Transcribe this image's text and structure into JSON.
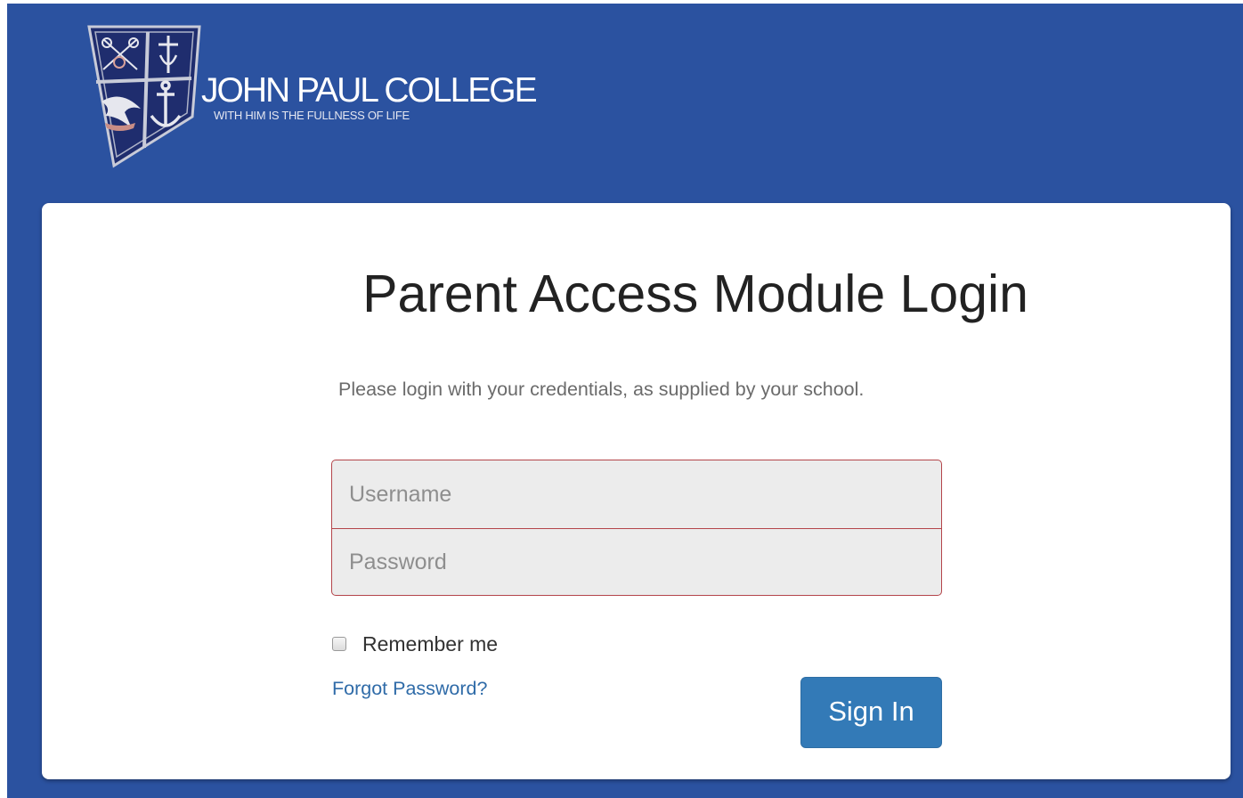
{
  "header": {
    "logo": {
      "school_name": "JOHN PAUL COLLEGE",
      "motto": "WITH HIM IS THE FULLNESS OF LIFE",
      "shield_icons": [
        "crossed-keys-icon",
        "cross-icon",
        "dolphin-icon",
        "anchor-icon"
      ]
    }
  },
  "login": {
    "title": "Parent Access Module Login",
    "instructions": "Please login with your credentials, as supplied by your school.",
    "username_placeholder": "Username",
    "password_placeholder": "Password",
    "remember_label": "Remember me",
    "forgot_label": "Forgot Password?",
    "signin_label": "Sign In"
  },
  "colors": {
    "background": "#2b52a0",
    "card": "#ffffff",
    "primary_button": "#337ab7",
    "link": "#2f6ba8",
    "input_error_border": "#b4454a",
    "input_background": "#ececec"
  }
}
